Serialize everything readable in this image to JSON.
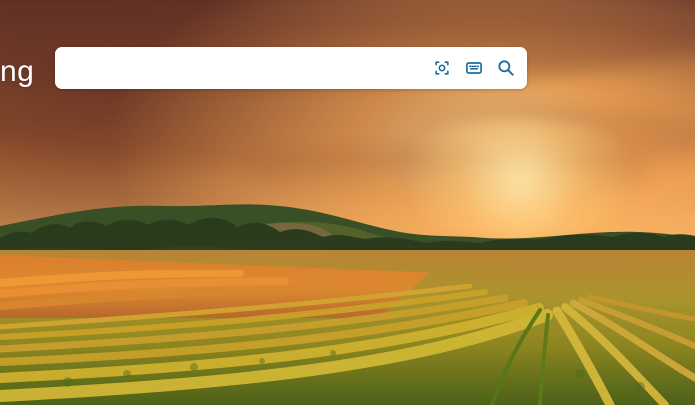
{
  "header": {
    "brand_fragment": "ng"
  },
  "search": {
    "value": "",
    "placeholder": "",
    "actions": [
      {
        "icon": "visual-search-icon"
      },
      {
        "icon": "keyboard-icon"
      },
      {
        "icon": "search-icon"
      }
    ]
  },
  "colors": {
    "accent": "#1d6f9d",
    "search_box_bg": "#ffffff",
    "brand_text": "#ffffff"
  }
}
